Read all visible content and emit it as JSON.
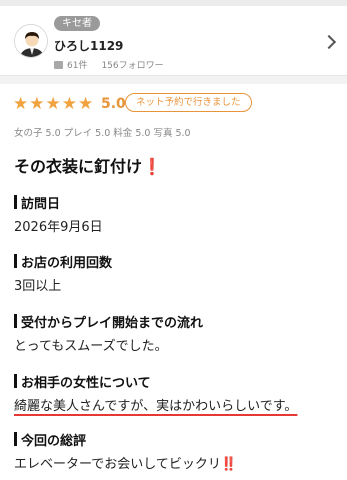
{
  "reviewer": {
    "badge": "キセ者",
    "name": "ひろし1129",
    "review_count": "61件",
    "followers": "156フォロワー"
  },
  "rating": {
    "stars": 5,
    "score": "5.0",
    "visit_pill": "ネット予約で行きました",
    "subscores": "女の子 5.0 プレイ 5.0 料金 5.0 写真 5.0"
  },
  "review": {
    "title": "その衣装に釘付け",
    "title_mark": "❗",
    "sections": [
      {
        "heading": "訪問日",
        "body": "2026年9月6日"
      },
      {
        "heading": "お店の利用回数",
        "body": "3回以上"
      },
      {
        "heading": "受付からプレイ開始までの流れ",
        "body": "とってもスムーズでした。"
      },
      {
        "heading": "お相手の女性について",
        "body": "綺麗な美人さんですが、実はかわいらしいです。"
      },
      {
        "heading": "今回の総評",
        "body": "エレベーターでお会いしてビックリ",
        "mark": "‼️"
      }
    ]
  },
  "colors": {
    "star": "#f0a33e",
    "accent": "#e8943a",
    "exclamation": "#d93025",
    "underline": "#e53935"
  }
}
